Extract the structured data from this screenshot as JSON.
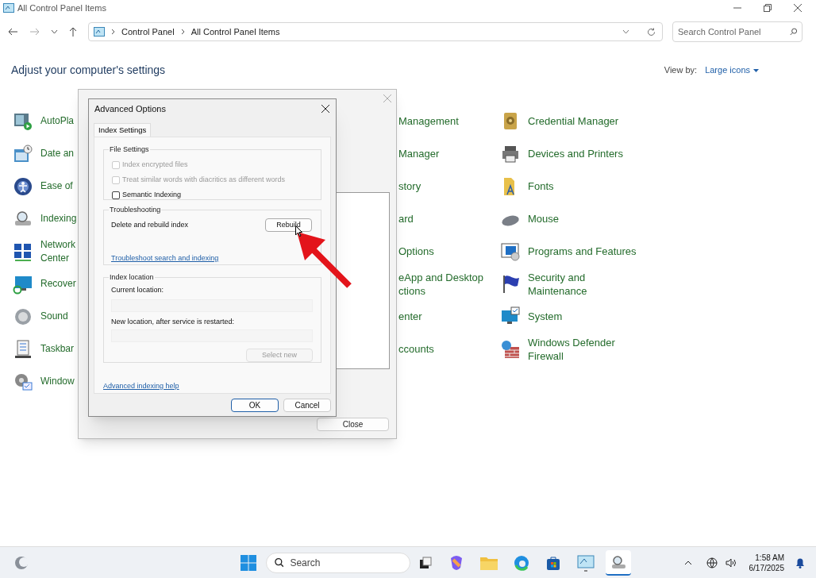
{
  "window": {
    "title": "All Control Panel Items"
  },
  "address_bar": {
    "breadcrumbs": [
      "Control Panel",
      "All Control Panel Items"
    ]
  },
  "search": {
    "placeholder": "Search Control Panel"
  },
  "heading": "Adjust your computer's settings",
  "view_by": {
    "label": "View by:",
    "value": "Large icons"
  },
  "columns": [
    [
      {
        "label": "AutoPla"
      },
      {
        "label": "Date an"
      },
      {
        "label": "Ease of"
      },
      {
        "label": "Indexing"
      },
      {
        "label": "Network Center"
      },
      {
        "label": "Recover"
      },
      {
        "label": "Sound"
      },
      {
        "label": "Taskbar"
      },
      {
        "label": "Window"
      }
    ],
    [
      {
        "label": "Management"
      },
      {
        "label": "Manager"
      },
      {
        "label": "story"
      },
      {
        "label": "ard"
      },
      {
        "label": "Options"
      },
      {
        "label": "eApp and Desktop ctions"
      },
      {
        "label": "enter"
      },
      {
        "label": "ccounts"
      }
    ],
    [
      {
        "label": "Credential Manager"
      },
      {
        "label": "Devices and Printers"
      },
      {
        "label": "Fonts"
      },
      {
        "label": "Mouse"
      },
      {
        "label": "Programs and Features"
      },
      {
        "label": "Security and Maintenance"
      },
      {
        "label": "System"
      },
      {
        "label": "Windows Defender Firewall"
      }
    ]
  ],
  "indexing_dialog": {
    "close_button": "Close"
  },
  "advanced_dialog": {
    "title": "Advanced Options",
    "tabs": [
      {
        "label": "Index Settings",
        "selected": true
      }
    ],
    "file_settings": {
      "title": "File Settings",
      "options": [
        {
          "label": "Index encrypted files",
          "checked": false,
          "disabled": true
        },
        {
          "label": "Treat similar words with diacritics as different words",
          "checked": false,
          "disabled": true
        },
        {
          "label": "Semantic Indexing",
          "checked": false,
          "disabled": false
        }
      ]
    },
    "troubleshooting": {
      "title": "Troubleshooting",
      "text": "Delete and rebuild index",
      "button": "Rebuild",
      "link": "Troubleshoot search and indexing"
    },
    "index_location": {
      "title": "Index location",
      "current_label": "Current location:",
      "new_label": "New location, after service is restarted:",
      "button": "Select new"
    },
    "help_link": "Advanced indexing help",
    "buttons": [
      "OK",
      "Cancel"
    ]
  },
  "taskbar": {
    "search_placeholder": "Search",
    "time": "1:58 AM",
    "date": "6/17/2025"
  }
}
